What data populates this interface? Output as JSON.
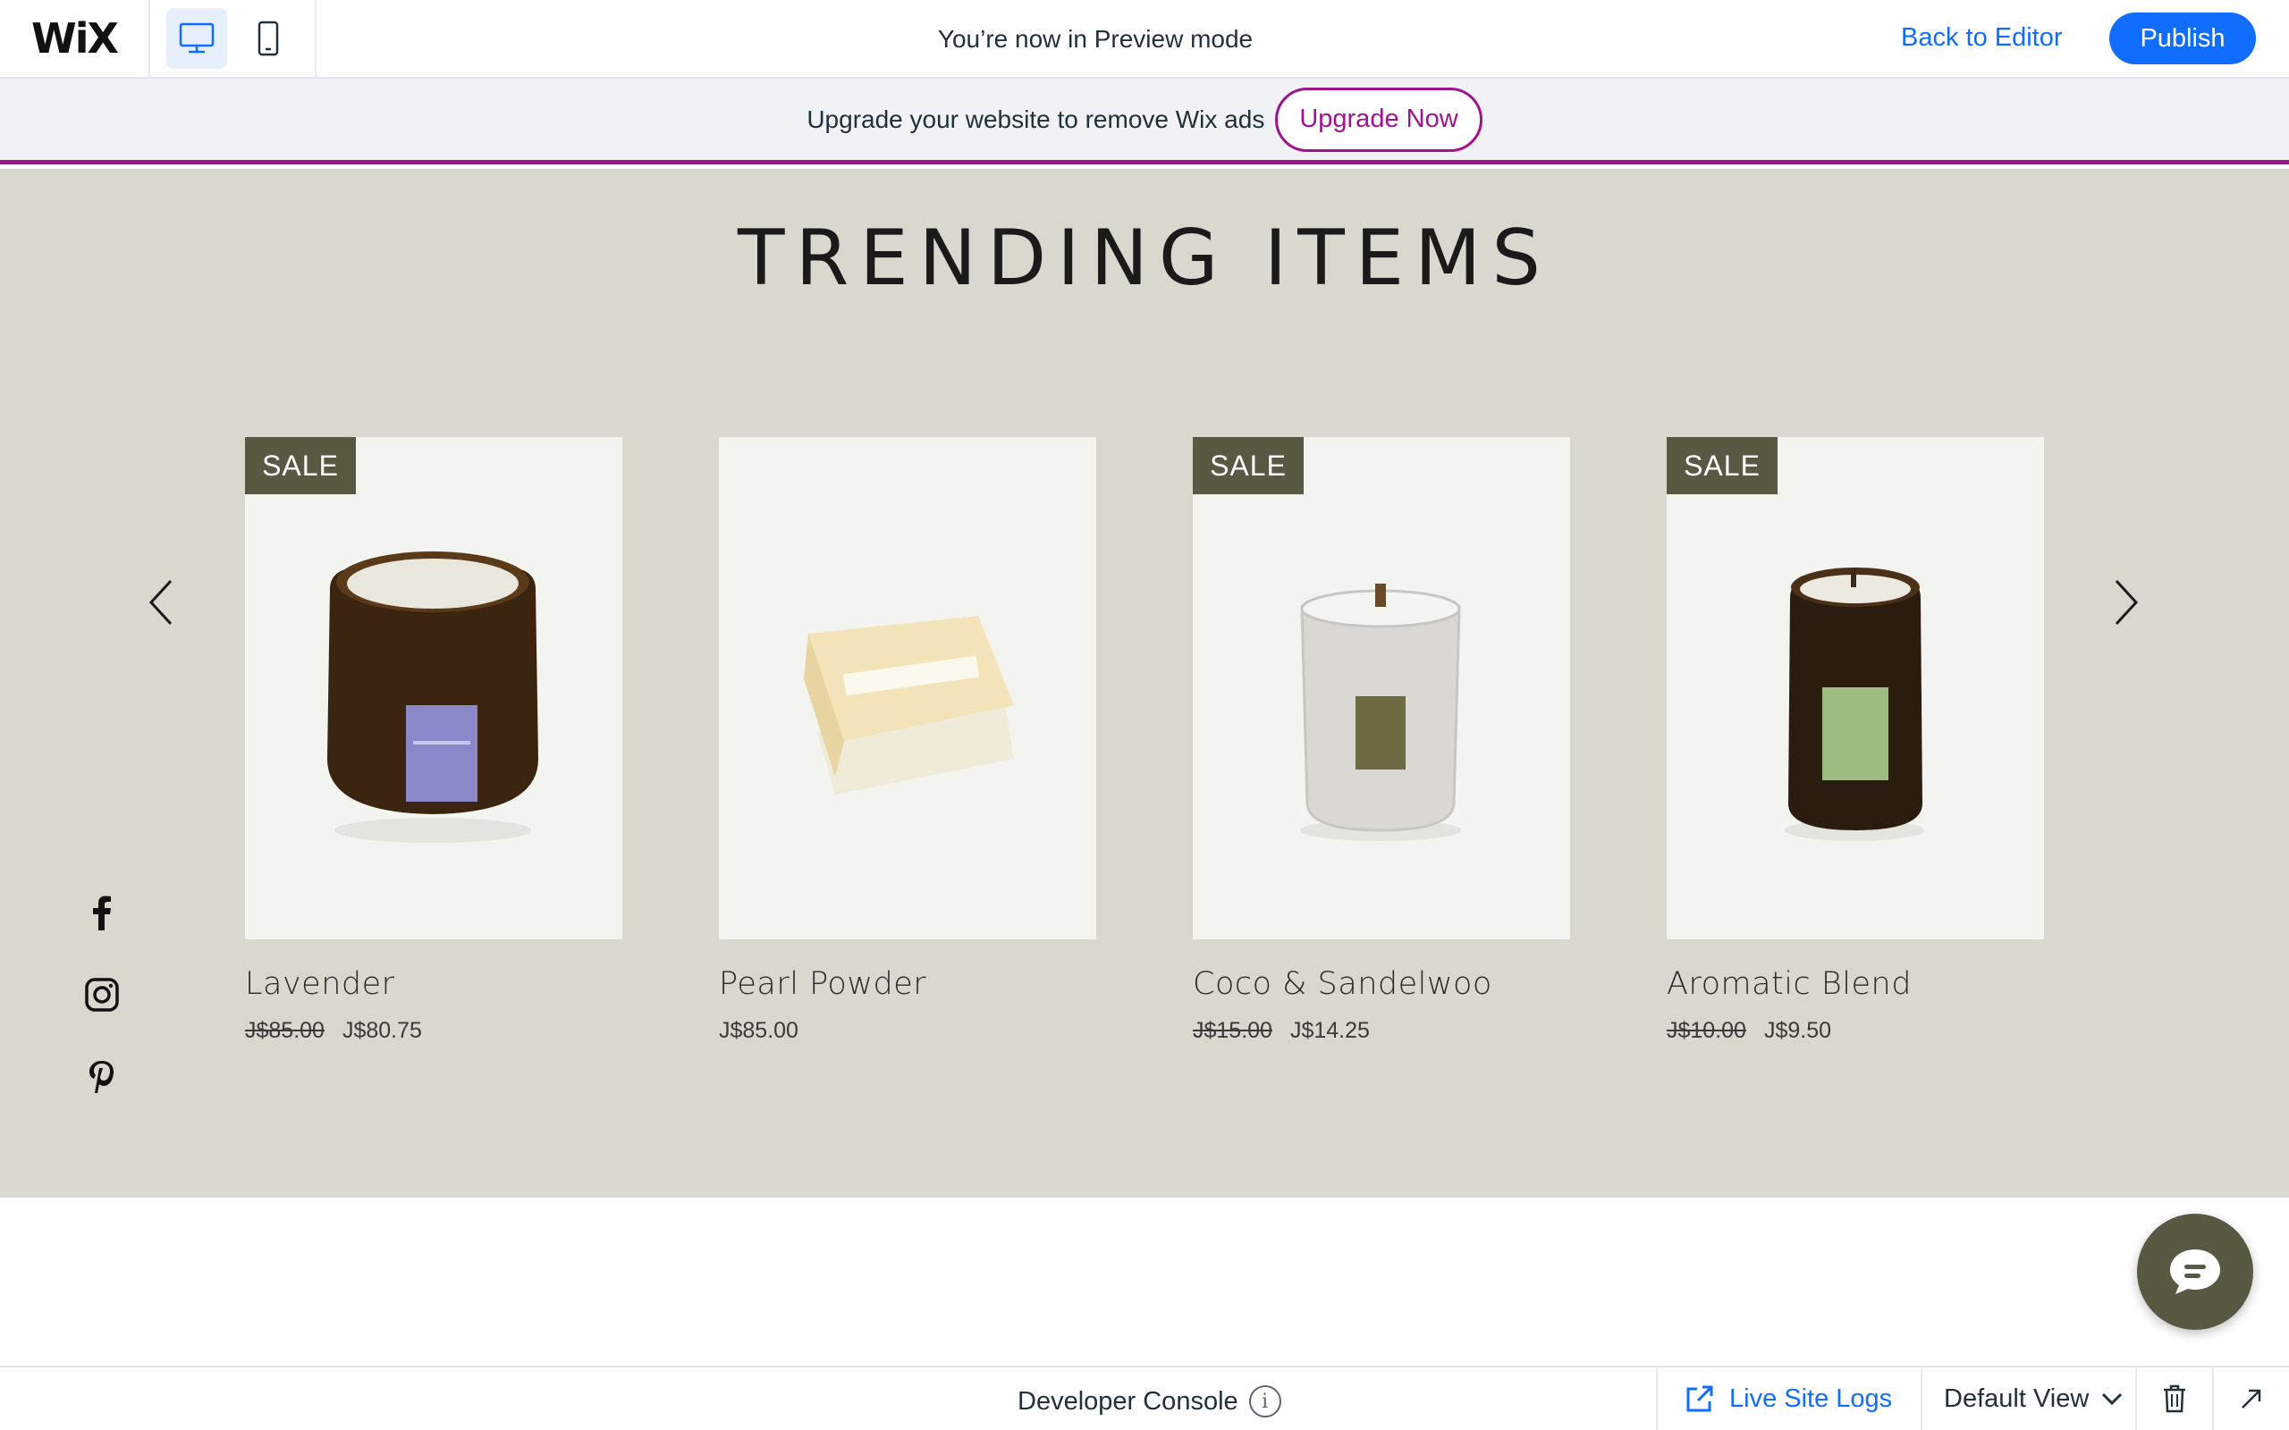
{
  "topbar": {
    "logo": "WiX",
    "preview_message": "You’re now in Preview mode",
    "back_to_editor": "Back to Editor",
    "publish": "Publish",
    "devices": [
      "desktop-icon",
      "mobile-icon"
    ]
  },
  "upgrade": {
    "text": "Upgrade your website to remove Wix ads",
    "button": "Upgrade Now"
  },
  "section": {
    "title": "TRENDING ITEMS",
    "products": [
      {
        "name": "Lavender",
        "badge": "SALE",
        "old_price": "J$85.00",
        "price": "J$80.75",
        "image": "amber-jar-candle-lavender-label"
      },
      {
        "name": "Pearl Powder",
        "badge": "",
        "old_price": "",
        "price": "J$85.00",
        "image": "soap-bar-stack"
      },
      {
        "name": "Coco & Sandelwoo",
        "badge": "SALE",
        "old_price": "J$15.00",
        "price": "J$14.25",
        "image": "glass-candle-wooden-wick"
      },
      {
        "name": "Aromatic Blend",
        "badge": "SALE",
        "old_price": "J$10.00",
        "price": "J$9.50",
        "image": "amber-jar-candle-green-label"
      }
    ]
  },
  "social": [
    "facebook-icon",
    "instagram-icon",
    "pinterest-icon"
  ],
  "devbar": {
    "title": "Developer Console",
    "live_logs": "Live Site Logs",
    "view": "Default View"
  },
  "colors": {
    "wix_blue": "#116dff",
    "upgrade_purple": "#a0138e",
    "section_bg": "#d8d8ce",
    "badge_olive": "#575943"
  }
}
